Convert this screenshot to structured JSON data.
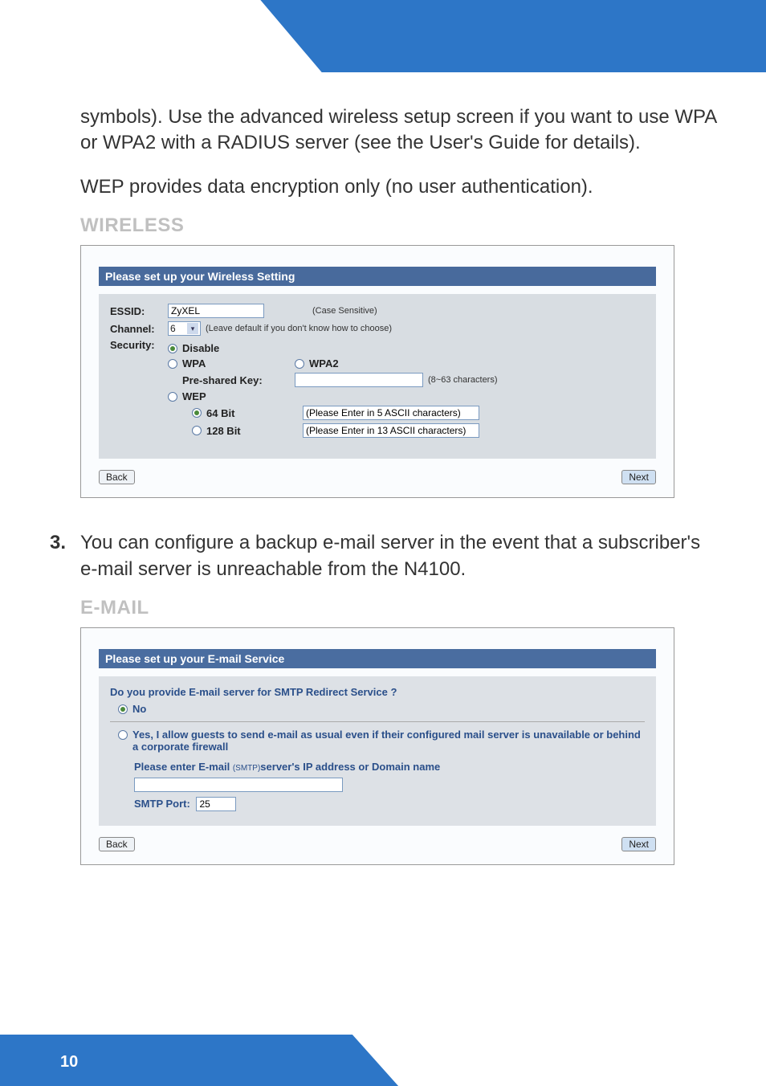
{
  "intro_paragraph": "symbols). Use the advanced wireless setup screen if you want to use WPA or WPA2 with a RADIUS server (see the User's Guide for details).",
  "wep_note": "WEP provides data encryption only (no user authentication).",
  "wireless_heading": "WIRELESS",
  "wireless": {
    "panel_title": "Please set up your Wireless Setting",
    "essid_label": "ESSID:",
    "essid_value": "ZyXEL",
    "essid_hint": "(Case Sensitive)",
    "channel_label": "Channel:",
    "channel_value": "6",
    "channel_hint": "(Leave default if you don't know how to choose)",
    "security_label": "Security:",
    "disable_label": "Disable",
    "wpa_label": "WPA",
    "wpa2_label": "WPA2",
    "psk_label": "Pre-shared Key:",
    "psk_hint": "(8~63 characters)",
    "wep_label": "WEP",
    "bit64_label": "64 Bit",
    "bit64_placeholder": "(Please Enter in 5 ASCII characters)",
    "bit128_label": "128 Bit",
    "bit128_placeholder": "(Please Enter in 13 ASCII characters)",
    "back_label": "Back",
    "next_label": "Next"
  },
  "step3_num": "3.",
  "step3_text": "You can configure a backup e-mail server in the event that a subscriber's e-mail server is unreachable from the N4100.",
  "email_heading": "E-MAIL",
  "email": {
    "panel_title": "Please set up your E-mail Service",
    "question": "Do you provide E-mail server for SMTP Redirect Service ?",
    "no_label": "No",
    "yes_label": "Yes, I allow guests to send e-mail as usual even if their configured mail server is unavailable or behind a corporate firewall",
    "enter_prefix": "Please enter E-mail ",
    "smtp_small": "(SMTP)",
    "enter_suffix": "server's IP address or Domain name",
    "server_value": "",
    "port_label": "SMTP Port:",
    "port_value": "25",
    "back_label": "Back",
    "next_label": "Next"
  },
  "page_number": "10"
}
